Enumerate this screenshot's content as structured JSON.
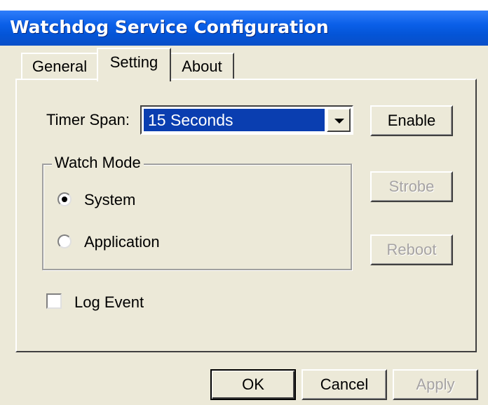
{
  "window": {
    "title": "Watchdog Service Configuration"
  },
  "tabs": [
    {
      "label": "General",
      "active": false
    },
    {
      "label": "Setting",
      "active": true
    },
    {
      "label": "About",
      "active": false
    }
  ],
  "settings": {
    "timer_span_label": "Timer Span:",
    "timer_span_value": "15 Seconds",
    "watch_mode": {
      "legend": "Watch Mode",
      "options": [
        {
          "label": "System",
          "checked": true
        },
        {
          "label": "Application",
          "checked": false
        }
      ]
    },
    "log_event": {
      "label": "Log Event",
      "checked": false
    },
    "side_buttons": {
      "enable": {
        "label": "Enable",
        "enabled": true
      },
      "strobe": {
        "label": "Strobe",
        "enabled": false
      },
      "reboot": {
        "label": "Reboot",
        "enabled": false
      }
    }
  },
  "footer": {
    "ok": {
      "label": "OK",
      "enabled": true
    },
    "cancel": {
      "label": "Cancel",
      "enabled": true
    },
    "apply": {
      "label": "Apply",
      "enabled": false
    }
  },
  "colors": {
    "titlebar": "#0a5fe8",
    "dialog_bg": "#ece9d8",
    "selection": "#0a3eb0",
    "disabled_text": "#a6a3a3"
  }
}
